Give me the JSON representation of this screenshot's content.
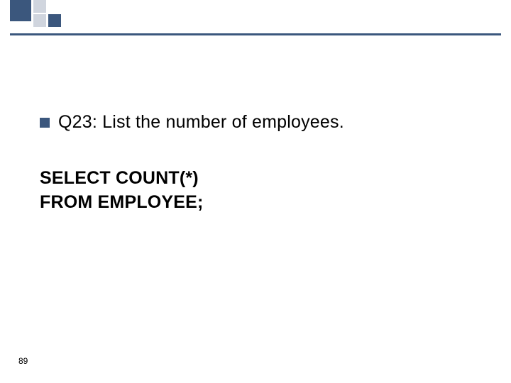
{
  "content": {
    "question_text": "Q23: List the number of employees.",
    "sql_line1": "SELECT COUNT(*)",
    "sql_line2": "FROM EMPLOYEE;"
  },
  "page_number": "89"
}
